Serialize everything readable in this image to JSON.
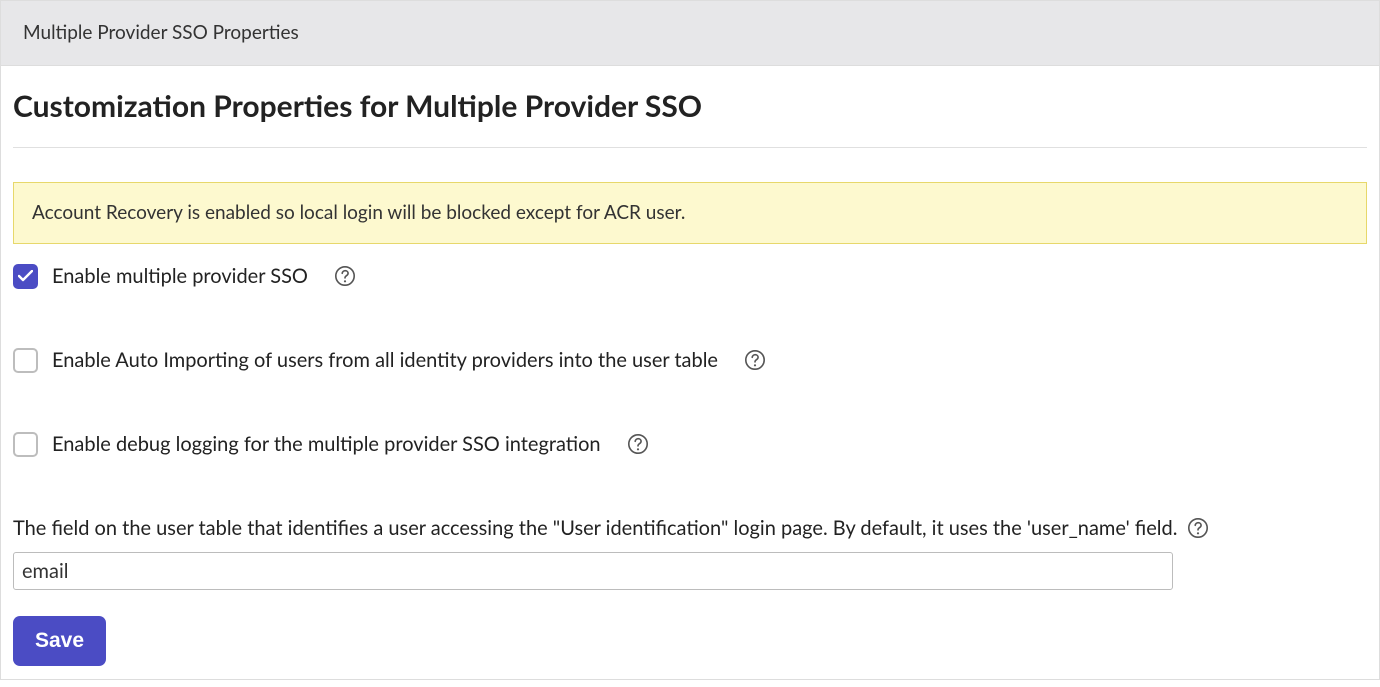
{
  "header": {
    "title": "Multiple Provider SSO Properties"
  },
  "page": {
    "title": "Customization Properties for Multiple Provider SSO"
  },
  "alert": {
    "message": "Account Recovery is enabled so local login will be blocked except for ACR user."
  },
  "options": {
    "enable_sso": {
      "label": "Enable multiple provider SSO",
      "checked": true
    },
    "auto_import": {
      "label": "Enable Auto Importing of users from all identity providers into the user table",
      "checked": false
    },
    "debug_logging": {
      "label": "Enable debug logging for the multiple provider SSO integration",
      "checked": false
    }
  },
  "user_field": {
    "label": "The field on the user table that identifies a user accessing the \"User identification\" login page. By default, it uses the 'user_name' field.",
    "value": "email"
  },
  "buttons": {
    "save": "Save"
  },
  "icons": {
    "help": "help-circle-icon",
    "check": "check-icon"
  }
}
